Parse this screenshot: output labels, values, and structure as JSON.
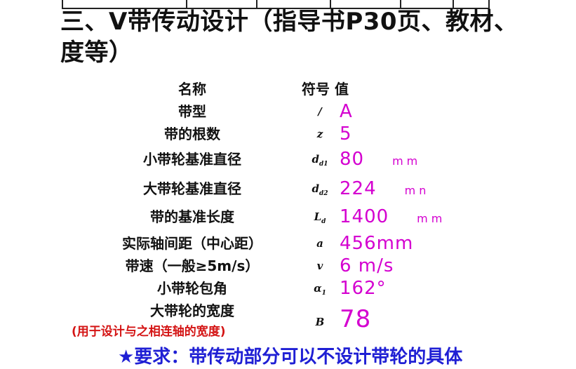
{
  "title_line1": "三、V带传动设计（指导书P30页、教材、",
  "title_line2": "度等）",
  "header": {
    "name": "名称",
    "symbol_value": "符号 值"
  },
  "rows": [
    {
      "name": "带型",
      "symbol": "/",
      "value": "A",
      "unit": ""
    },
    {
      "name": "带的根数",
      "symbol": "z",
      "value": "5",
      "unit": ""
    },
    {
      "name": "小带轮基准直径",
      "symbol": "d",
      "sub": "d1",
      "value": "80",
      "unit": "mm"
    },
    {
      "name": "大带轮基准直径",
      "symbol": "d",
      "sub": "d2",
      "value": "224",
      "unit": "mn"
    },
    {
      "name": "带的基准长度",
      "symbol": "L",
      "sub": "d",
      "value": "1400",
      "unit": "mm"
    },
    {
      "name": "实际轴间距（中心距）",
      "symbol": "a",
      "value": "456mm",
      "unit": ""
    },
    {
      "name": "带速（一般≥5m/s）",
      "symbol": "v",
      "value": "6 m/s",
      "unit": ""
    },
    {
      "name": "小带轮包角",
      "symbol": "α",
      "sub": "1",
      "value": "162°",
      "unit": ""
    },
    {
      "name": "大带轮的宽度",
      "symbol": "B",
      "value": "78",
      "unit": ""
    }
  ],
  "note": "(用于设计与之相连轴的宽度)",
  "requirement": "★要求：带传动部分可以不设计带轮的具体",
  "colors": {
    "handwriting": "#d400d0",
    "note": "#d41414",
    "requirement": "#1f1fd4"
  }
}
